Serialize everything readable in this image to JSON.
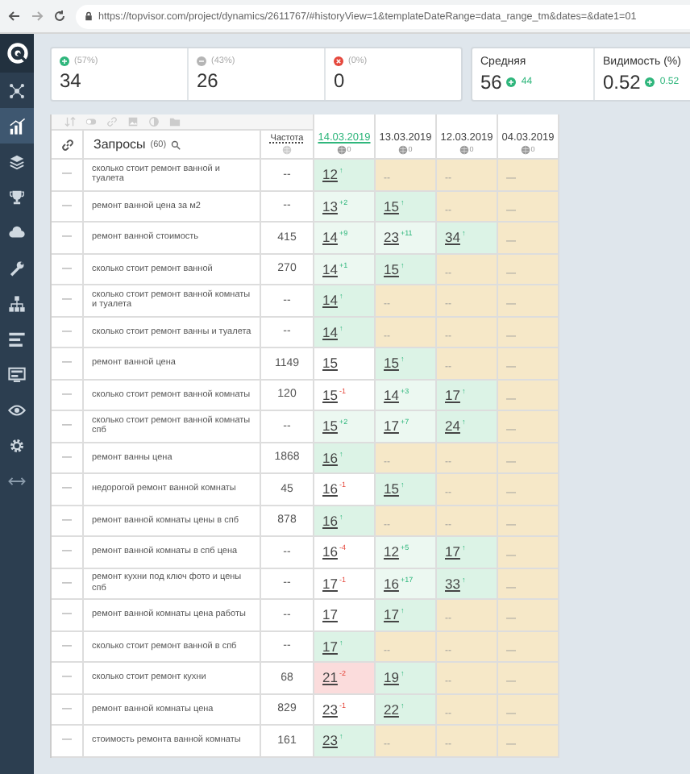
{
  "browser": {
    "url": "https://topvisor.com/project/dynamics/2611767/#historyView=1&templateDateRange=data_range_tm&dates=&date1=01"
  },
  "sidebar": [
    {
      "kind": "network",
      "selected": false
    },
    {
      "kind": "chart",
      "selected": true
    },
    {
      "kind": "layers",
      "selected": false
    },
    {
      "kind": "trophy",
      "selected": false
    },
    {
      "kind": "cloud",
      "selected": false
    },
    {
      "kind": "wrench",
      "selected": false
    },
    {
      "kind": "hierarchy",
      "selected": false
    },
    {
      "kind": "bars",
      "selected": false
    },
    {
      "kind": "monitor",
      "selected": false
    },
    {
      "kind": "eye",
      "selected": false
    },
    {
      "kind": "gear",
      "selected": false
    },
    {
      "kind": "arrows",
      "selected": false
    }
  ],
  "stats": [
    {
      "kind": "plus",
      "share": "(57%)",
      "value": "34"
    },
    {
      "kind": "neutral",
      "share": "(43%)",
      "value": "26"
    },
    {
      "kind": "minus",
      "share": "(0%)",
      "value": "0"
    }
  ],
  "summary": [
    {
      "title": "Средняя",
      "value": "56",
      "delta": "44"
    },
    {
      "title": "Видимость (%)",
      "value": "0.52",
      "delta": "0.52"
    }
  ],
  "table": {
    "query_heading": "Запросы",
    "query_count": "(60)",
    "frequency_heading": "Частота",
    "dates": [
      {
        "label": "14.03.2019",
        "selected": true,
        "count": "0"
      },
      {
        "label": "13.03.2019",
        "selected": false,
        "count": "0"
      },
      {
        "label": "12.03.2019",
        "selected": false,
        "count": "0"
      },
      {
        "label": "04.03.2019",
        "selected": false,
        "count": "0"
      }
    ],
    "rows": [
      {
        "mark": "—",
        "query": "сколько стоит ремонт ванной и туалета",
        "frequency": "--",
        "positions": [
          {
            "value": "12",
            "change": "↑",
            "kind": "new",
            "color": "#dcf3e6"
          },
          {
            "value": "--",
            "kind": "none",
            "color": "#f6e8c8"
          },
          {
            "value": "--",
            "kind": "none",
            "color": "#f6e8c8"
          },
          {
            "value": "—",
            "kind": "none",
            "color": "#f6e8c8"
          }
        ]
      },
      {
        "mark": "—",
        "query": "ремонт ванной цена за м2",
        "frequency": "--",
        "positions": [
          {
            "value": "13",
            "change": "+2",
            "kind": "up",
            "color": "#ecf8f1"
          },
          {
            "value": "15",
            "change": "↑",
            "kind": "new",
            "color": "#dcf3e6"
          },
          {
            "value": "--",
            "kind": "none",
            "color": "#f6e8c8"
          },
          {
            "value": "—",
            "kind": "none",
            "color": "#f6e8c8"
          }
        ]
      },
      {
        "mark": "—",
        "query": "ремонт ванной стоимость",
        "frequency": "415",
        "positions": [
          {
            "value": "14",
            "change": "+9",
            "kind": "up",
            "color": "#ecf8f1"
          },
          {
            "value": "23",
            "change": "+11",
            "kind": "up",
            "color": "#ecf8f1"
          },
          {
            "value": "34",
            "change": "↑",
            "kind": "new",
            "color": "#dcf3e6"
          },
          {
            "value": "—",
            "kind": "none",
            "color": "#f6e8c8"
          }
        ]
      },
      {
        "mark": "—",
        "query": "сколько стоит ремонт ванной",
        "frequency": "270",
        "positions": [
          {
            "value": "14",
            "change": "+1",
            "kind": "up",
            "color": "#ecf8f1"
          },
          {
            "value": "15",
            "change": "↑",
            "kind": "new",
            "color": "#dcf3e6"
          },
          {
            "value": "--",
            "kind": "none",
            "color": "#f6e8c8"
          },
          {
            "value": "—",
            "kind": "none",
            "color": "#f6e8c8"
          }
        ]
      },
      {
        "mark": "—",
        "query": "сколько стоит ремонт ванной комнаты и туалета",
        "frequency": "--",
        "positions": [
          {
            "value": "14",
            "change": "↑",
            "kind": "new",
            "color": "#dcf3e6"
          },
          {
            "value": "--",
            "kind": "none",
            "color": "#f6e8c8"
          },
          {
            "value": "--",
            "kind": "none",
            "color": "#f6e8c8"
          },
          {
            "value": "—",
            "kind": "none",
            "color": "#f6e8c8"
          }
        ]
      },
      {
        "mark": "—",
        "query": "сколько стоит ремонт ванны и туалета",
        "frequency": "--",
        "positions": [
          {
            "value": "14",
            "change": "↑",
            "kind": "new",
            "color": "#dcf3e6"
          },
          {
            "value": "--",
            "kind": "none",
            "color": "#f6e8c8"
          },
          {
            "value": "--",
            "kind": "none",
            "color": "#f6e8c8"
          },
          {
            "value": "—",
            "kind": "none",
            "color": "#f6e8c8"
          }
        ]
      },
      {
        "mark": "—",
        "query": "ремонт ванной цена",
        "frequency": "1149",
        "positions": [
          {
            "value": "15",
            "kind": "same",
            "color": "#ffffff"
          },
          {
            "value": "15",
            "change": "↑",
            "kind": "new",
            "color": "#dcf3e6"
          },
          {
            "value": "--",
            "kind": "none",
            "color": "#f6e8c8"
          },
          {
            "value": "—",
            "kind": "none",
            "color": "#f6e8c8"
          }
        ]
      },
      {
        "mark": "—",
        "query": "сколько стоит ремонт ванной комнаты",
        "frequency": "120",
        "positions": [
          {
            "value": "15",
            "change": "-1",
            "kind": "down",
            "color": "#ffffff"
          },
          {
            "value": "14",
            "change": "+3",
            "kind": "up",
            "color": "#ecf8f1"
          },
          {
            "value": "17",
            "change": "↑",
            "kind": "new",
            "color": "#dcf3e6"
          },
          {
            "value": "—",
            "kind": "none",
            "color": "#f6e8c8"
          }
        ]
      },
      {
        "mark": "—",
        "query": "сколько стоит ремонт ванной комнаты спб",
        "frequency": "--",
        "positions": [
          {
            "value": "15",
            "change": "+2",
            "kind": "up",
            "color": "#ecf8f1"
          },
          {
            "value": "17",
            "change": "+7",
            "kind": "up",
            "color": "#ecf8f1"
          },
          {
            "value": "24",
            "change": "↑",
            "kind": "new",
            "color": "#dcf3e6"
          },
          {
            "value": "—",
            "kind": "none",
            "color": "#f6e8c8"
          }
        ]
      },
      {
        "mark": "—",
        "query": "ремонт ванны цена",
        "frequency": "1868",
        "positions": [
          {
            "value": "16",
            "change": "↑",
            "kind": "new",
            "color": "#dcf3e6"
          },
          {
            "value": "--",
            "kind": "none",
            "color": "#f6e8c8"
          },
          {
            "value": "--",
            "kind": "none",
            "color": "#f6e8c8"
          },
          {
            "value": "—",
            "kind": "none",
            "color": "#f6e8c8"
          }
        ]
      },
      {
        "mark": "—",
        "query": "недорогой ремонт ванной комнаты",
        "frequency": "45",
        "positions": [
          {
            "value": "16",
            "change": "-1",
            "kind": "down",
            "color": "#ffffff"
          },
          {
            "value": "15",
            "change": "↑",
            "kind": "new",
            "color": "#dcf3e6"
          },
          {
            "value": "--",
            "kind": "none",
            "color": "#f6e8c8"
          },
          {
            "value": "—",
            "kind": "none",
            "color": "#f6e8c8"
          }
        ]
      },
      {
        "mark": "—",
        "query": "ремонт ванной комнаты цены в спб",
        "frequency": "878",
        "positions": [
          {
            "value": "16",
            "change": "↑",
            "kind": "new",
            "color": "#dcf3e6"
          },
          {
            "value": "--",
            "kind": "none",
            "color": "#f6e8c8"
          },
          {
            "value": "--",
            "kind": "none",
            "color": "#f6e8c8"
          },
          {
            "value": "—",
            "kind": "none",
            "color": "#f6e8c8"
          }
        ]
      },
      {
        "mark": "—",
        "query": "ремонт ванной комнаты в спб цена",
        "frequency": "--",
        "positions": [
          {
            "value": "16",
            "change": "-4",
            "kind": "down",
            "color": "#ffffff"
          },
          {
            "value": "12",
            "change": "+5",
            "kind": "up",
            "color": "#ecf8f1"
          },
          {
            "value": "17",
            "change": "↑",
            "kind": "new",
            "color": "#dcf3e6"
          },
          {
            "value": "—",
            "kind": "none",
            "color": "#f6e8c8"
          }
        ]
      },
      {
        "mark": "—",
        "query": "ремонт кухни под ключ фото и цены спб",
        "frequency": "--",
        "positions": [
          {
            "value": "17",
            "change": "-1",
            "kind": "down",
            "color": "#ffffff"
          },
          {
            "value": "16",
            "change": "+17",
            "kind": "up",
            "color": "#ecf8f1"
          },
          {
            "value": "33",
            "change": "↑",
            "kind": "new",
            "color": "#dcf3e6"
          },
          {
            "value": "—",
            "kind": "none",
            "color": "#f6e8c8"
          }
        ]
      },
      {
        "mark": "—",
        "query": "ремонт ванной комнаты цена работы",
        "frequency": "--",
        "positions": [
          {
            "value": "17",
            "kind": "same",
            "color": "#ffffff"
          },
          {
            "value": "17",
            "change": "↑",
            "kind": "new",
            "color": "#dcf3e6"
          },
          {
            "value": "--",
            "kind": "none",
            "color": "#f6e8c8"
          },
          {
            "value": "—",
            "kind": "none",
            "color": "#f6e8c8"
          }
        ]
      },
      {
        "mark": "—",
        "query": "сколько стоит ремонт ванной в спб",
        "frequency": "--",
        "positions": [
          {
            "value": "17",
            "change": "↑",
            "kind": "new",
            "color": "#dcf3e6"
          },
          {
            "value": "--",
            "kind": "none",
            "color": "#f6e8c8"
          },
          {
            "value": "--",
            "kind": "none",
            "color": "#f6e8c8"
          },
          {
            "value": "—",
            "kind": "none",
            "color": "#f6e8c8"
          }
        ]
      },
      {
        "mark": "—",
        "query": "сколько стоит ремонт кухни",
        "frequency": "68",
        "positions": [
          {
            "value": "21",
            "change": "-2",
            "kind": "down",
            "color": "#fbdcdc"
          },
          {
            "value": "19",
            "change": "↑",
            "kind": "new",
            "color": "#dcf3e6"
          },
          {
            "value": "--",
            "kind": "none",
            "color": "#f6e8c8"
          },
          {
            "value": "—",
            "kind": "none",
            "color": "#f6e8c8"
          }
        ]
      },
      {
        "mark": "—",
        "query": "ремонт ванной комнаты цена",
        "frequency": "829",
        "positions": [
          {
            "value": "23",
            "change": "-1",
            "kind": "down",
            "color": "#ffffff"
          },
          {
            "value": "22",
            "change": "↑",
            "kind": "new",
            "color": "#dcf3e6"
          },
          {
            "value": "--",
            "kind": "none",
            "color": "#f6e8c8"
          },
          {
            "value": "—",
            "kind": "none",
            "color": "#f6e8c8"
          }
        ]
      },
      {
        "mark": "—",
        "query": "стоимость ремонта ванной комнаты",
        "frequency": "161",
        "positions": [
          {
            "value": "23",
            "change": "↑",
            "kind": "new",
            "color": "#dcf3e6"
          },
          {
            "value": "--",
            "kind": "none",
            "color": "#f6e8c8"
          },
          {
            "value": "--",
            "kind": "none",
            "color": "#f6e8c8"
          },
          {
            "value": "—",
            "kind": "none",
            "color": "#f6e8c8"
          }
        ]
      }
    ]
  }
}
